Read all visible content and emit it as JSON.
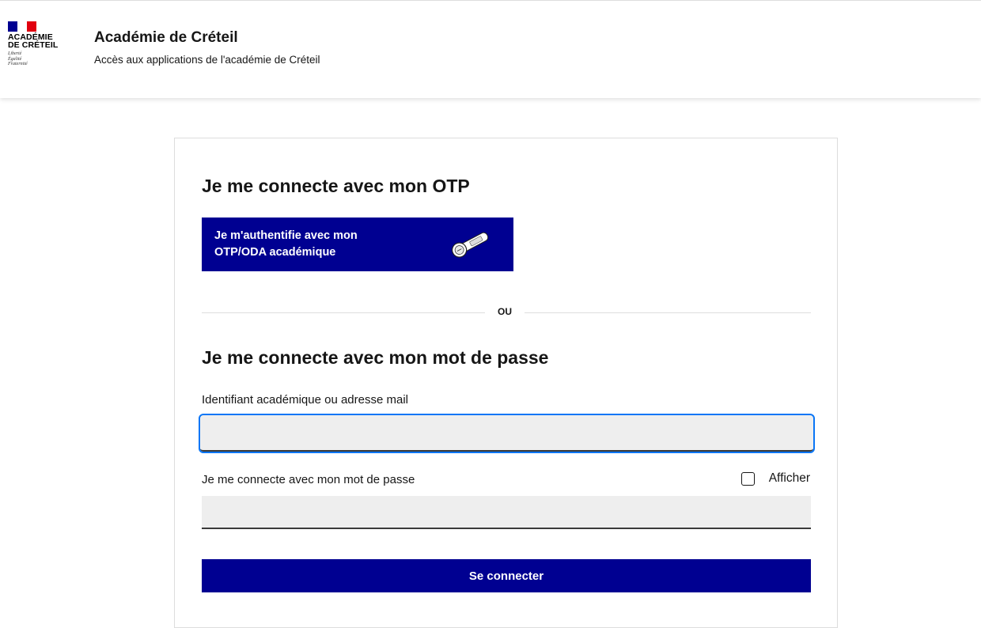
{
  "header": {
    "logo": {
      "line1": "ACADÉMIE",
      "line2": "DE CRÉTEIL",
      "motto": [
        "Liberté",
        "Égalité",
        "Fraternité"
      ]
    },
    "title": "Académie de Créteil",
    "subtitle": "Accès aux applications de l'académie de Créteil"
  },
  "otp_section": {
    "title": "Je me connecte avec mon OTP",
    "button_label": "Je m'authentifie avec mon OTP/ODA académique",
    "button_icon": "otp-token-icon"
  },
  "separator": {
    "text": "OU"
  },
  "password_section": {
    "title": "Je me connecte avec mon mot de passe",
    "identifier": {
      "label": "Identifiant académique ou adresse mail",
      "value": "",
      "placeholder": ""
    },
    "password": {
      "label": "Je me connecte avec mon mot de passe",
      "value": "",
      "placeholder": ""
    },
    "show_password": {
      "label": "Afficher",
      "checked": false
    },
    "submit_label": "Se connecter"
  },
  "colors": {
    "primary": "#000091",
    "focus": "#0a76f6",
    "flag_blue": "#000091",
    "flag_red": "#e1000f",
    "input_bg": "#eeeeee"
  }
}
